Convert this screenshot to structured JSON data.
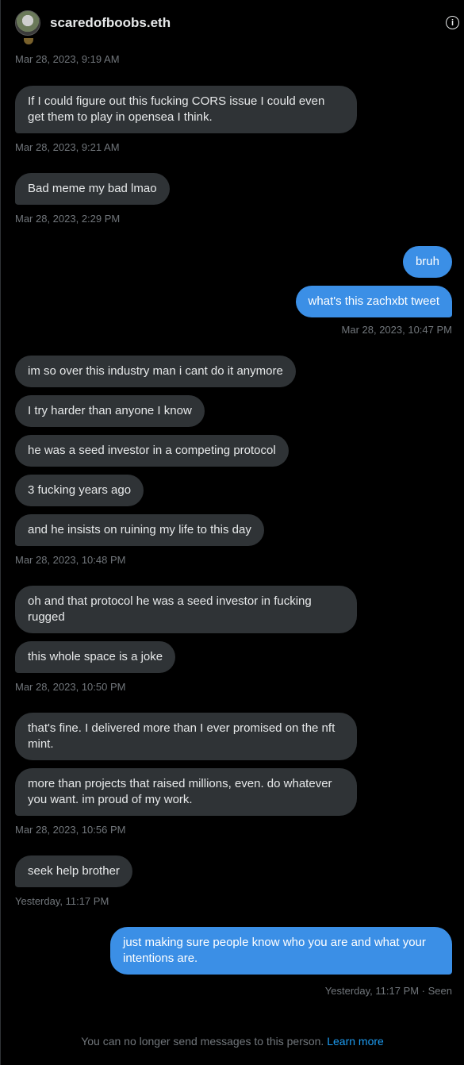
{
  "header": {
    "username": "scaredofboobs.eth",
    "info_icon": "info-icon"
  },
  "messages": [
    {
      "text": "If I could figure out this fucking CORS issue I could even get them to play in opensea I think.",
      "dir": "in"
    },
    {
      "text": "Bad meme my bad lmao",
      "dir": "in"
    },
    {
      "text": "bruh",
      "dir": "out"
    },
    {
      "text": "what's this zachxbt tweet",
      "dir": "out"
    },
    {
      "text": "im so over this industry man i cant do it anymore",
      "dir": "in"
    },
    {
      "text": "I try harder than anyone I know",
      "dir": "in"
    },
    {
      "text": "he was a seed investor in a competing protocol",
      "dir": "in"
    },
    {
      "text": "3 fucking years ago",
      "dir": "in"
    },
    {
      "text": "and he insists on ruining my life to this day",
      "dir": "in"
    },
    {
      "text": "oh and that protocol he was a seed investor in fucking rugged",
      "dir": "in"
    },
    {
      "text": "this whole space is a joke",
      "dir": "in"
    },
    {
      "text": "that's fine.  I delivered more than I ever promised on the nft mint.",
      "dir": "in"
    },
    {
      "text": "more than projects that raised millions, even.  do whatever you want.  im proud of my work.",
      "dir": "in"
    },
    {
      "text": "seek help brother",
      "dir": "in"
    },
    {
      "text": "just making sure people know who you are and what your intentions are.",
      "dir": "out"
    }
  ],
  "timestamps": [
    "Mar 28, 2023, 9:19 AM",
    "Mar 28, 2023, 9:21 AM",
    "Mar 28, 2023, 2:29 PM",
    "Mar 28, 2023, 10:47 PM",
    "Mar 28, 2023, 10:48 PM",
    "Mar 28, 2023, 10:50 PM",
    "Mar 28, 2023, 10:56 PM",
    "Yesterday, 11:17 PM",
    "Yesterday, 11:17 PM · Seen"
  ],
  "footer": {
    "notice": "You can no longer send messages to this person.",
    "link": "Learn more"
  }
}
